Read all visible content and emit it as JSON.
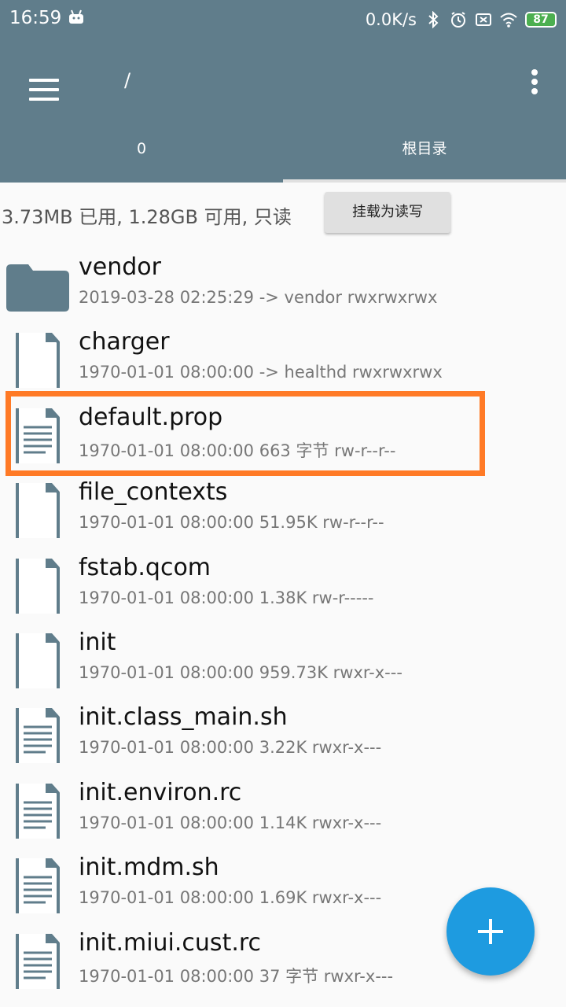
{
  "status_bar": {
    "time": "16:59",
    "net_speed": "0.0K/s",
    "battery": "87",
    "icons": [
      "android-icon",
      "bluetooth-icon",
      "alarm-icon",
      "sim-icon",
      "wifi-icon",
      "battery-icon"
    ]
  },
  "toolbar": {
    "path": "/",
    "menu_icon": "hamburger-menu-icon",
    "more_icon": "more-vert-icon"
  },
  "tabs": [
    {
      "label": "0",
      "selected": false
    },
    {
      "label": "根目录",
      "selected": true
    }
  ],
  "storage": {
    "info": "3.73MB 已用, 1.28GB 可用, 只读",
    "mount_button": "挂载为读写"
  },
  "files": [
    {
      "name": "vendor",
      "meta": "2019-03-28 02:25:29  -> vendor  rwxrwxrwx",
      "icon": "folder-icon"
    },
    {
      "name": "charger",
      "meta": "1970-01-01 08:00:00  -> healthd  rwxrwxrwx",
      "icon": "file-icon"
    },
    {
      "name": "default.prop",
      "meta": "1970-01-01 08:00:00  663 字节  rw-r--r--",
      "icon": "text-file-icon"
    },
    {
      "name": "file_contexts",
      "meta": "1970-01-01 08:00:00  51.95K  rw-r--r--",
      "icon": "file-icon"
    },
    {
      "name": "fstab.qcom",
      "meta": "1970-01-01 08:00:00  1.38K  rw-r-----",
      "icon": "file-icon"
    },
    {
      "name": "init",
      "meta": "1970-01-01 08:00:00  959.73K  rwxr-x---",
      "icon": "file-icon"
    },
    {
      "name": "init.class_main.sh",
      "meta": "1970-01-01 08:00:00  3.22K  rwxr-x---",
      "icon": "text-file-icon"
    },
    {
      "name": "init.environ.rc",
      "meta": "1970-01-01 08:00:00  1.14K  rwxr-x---",
      "icon": "text-file-icon"
    },
    {
      "name": "init.mdm.sh",
      "meta": "1970-01-01 08:00:00  1.69K  rwxr-x---",
      "icon": "text-file-icon"
    },
    {
      "name": "init.miui.cust.rc",
      "meta": "1970-01-01 08:00:00  37 字节  rwxr-x---",
      "icon": "text-file-icon"
    }
  ],
  "fab": {
    "icon": "add-icon"
  },
  "colors": {
    "primary": "#607d8b",
    "accent": "#1e9be0",
    "highlight": "#ff7a26",
    "icon": "#607d8b"
  }
}
